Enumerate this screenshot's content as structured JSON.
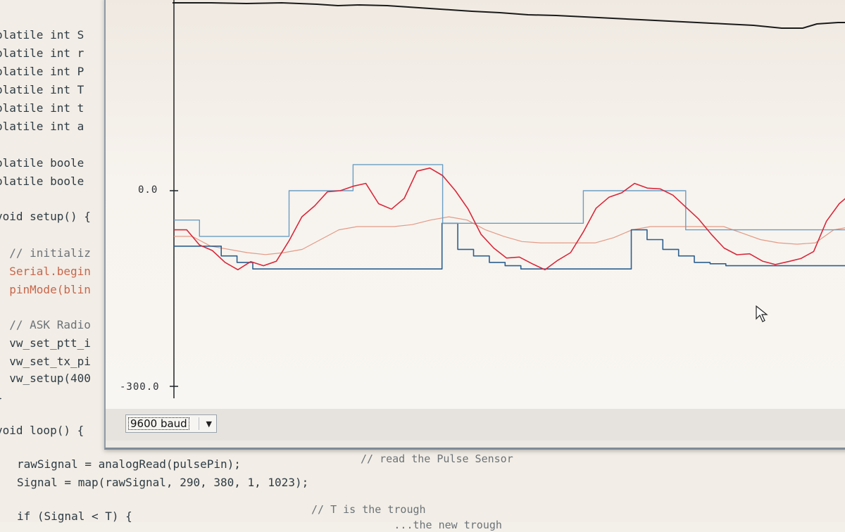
{
  "editor": {
    "lines_top": [
      "olatile int S",
      "olatile int r",
      "olatile int P",
      "olatile int T",
      "olatile int t",
      "olatile int a",
      "olatile boole",
      "olatile boole",
      "void setup() {",
      "  // initializ",
      "  Serial.begin",
      "  pinMode(blin",
      "  // ASK Radio",
      "  vw_set_ptt_i",
      "  vw_set_tx_pi",
      "  vw_setup(400",
      "}",
      "void loop() {"
    ],
    "code_bottom": {
      "line1": "rawSignal = analogRead(pulsePin);",
      "line1_comment": "// read the Pulse Sensor",
      "line2": "Signal = map(rawSignal, 290, 380, 1, 1023);",
      "line3": "if (Signal < T) {",
      "line3_comment": "// T is the trough",
      "line4_partial": "             ...the new trough"
    }
  },
  "plotter": {
    "y_ticks": [
      "0.0",
      "-300.0"
    ],
    "baud": {
      "selected": "9600 baud",
      "arrow_icon": "dropdown-triangle"
    },
    "colors": {
      "pulse": "#d8283a",
      "peak": "#6a9ec4",
      "trough": "#2d5f8f",
      "threshold": "#e49a86",
      "top_signal": "#1b1b1b",
      "axis": "#1e2226"
    }
  },
  "chart_data": {
    "type": "line",
    "ylim": [
      -300,
      0
    ],
    "y_ticks": [
      0,
      -300
    ],
    "series": [
      {
        "key": "pulse",
        "values": [
          -60,
          -60,
          -80,
          -95,
          -110,
          -118,
          -112,
          -115,
          -105,
          -80,
          -40,
          -20,
          -5,
          0,
          10,
          8,
          -20,
          -25,
          -15,
          30,
          38,
          20,
          0,
          -25,
          -70,
          -88,
          -100,
          -105,
          -112,
          -118,
          -110,
          -95,
          -60,
          -30,
          -10,
          0,
          8,
          4,
          6,
          -10,
          -25,
          -40,
          -70,
          -88,
          -95,
          -100,
          -108,
          -110,
          -112,
          -104,
          -90,
          -50,
          -20,
          0
        ]
      },
      {
        "key": "peak",
        "values": [
          -45,
          -45,
          -70,
          -70,
          -70,
          -70,
          -70,
          -70,
          -70,
          0,
          0,
          0,
          0,
          0,
          40,
          40,
          40,
          40,
          40,
          40,
          40,
          -50,
          -50,
          -50,
          -50,
          -50,
          -50,
          -50,
          -50,
          -50,
          -50,
          -50,
          0,
          0,
          0,
          0,
          0,
          0,
          0,
          0,
          -60,
          -60,
          -60,
          -60,
          -60,
          -60,
          -60,
          -60,
          -60,
          -60,
          -60,
          -60,
          -60,
          -50
        ]
      },
      {
        "key": "trough",
        "values": [
          -85,
          -85,
          -85,
          -100,
          -110,
          -120,
          -120,
          -120,
          -120,
          -120,
          -120,
          -120,
          -120,
          -120,
          -120,
          -120,
          -120,
          -50,
          -90,
          -100,
          -110,
          -115,
          -120,
          -120,
          -120,
          -120,
          -120,
          -120,
          -120,
          -60,
          -75,
          -90,
          -100,
          -110,
          -112,
          -115,
          -115,
          -115,
          -115,
          -115,
          -115,
          -115,
          -115,
          -115
        ]
      },
      {
        "key": "threshold",
        "values": [
          -70,
          -70,
          -85,
          -90,
          -95,
          -98,
          -95,
          -90,
          -75,
          -60,
          -55,
          -55,
          -55,
          -52,
          -45,
          -40,
          -45,
          -60,
          -70,
          -78,
          -80,
          -80,
          -80,
          -80,
          -72,
          -60,
          -55,
          -55,
          -55,
          -55,
          -55,
          -65,
          -75,
          -80,
          -82,
          -80,
          -60,
          -55
        ]
      }
    ]
  }
}
